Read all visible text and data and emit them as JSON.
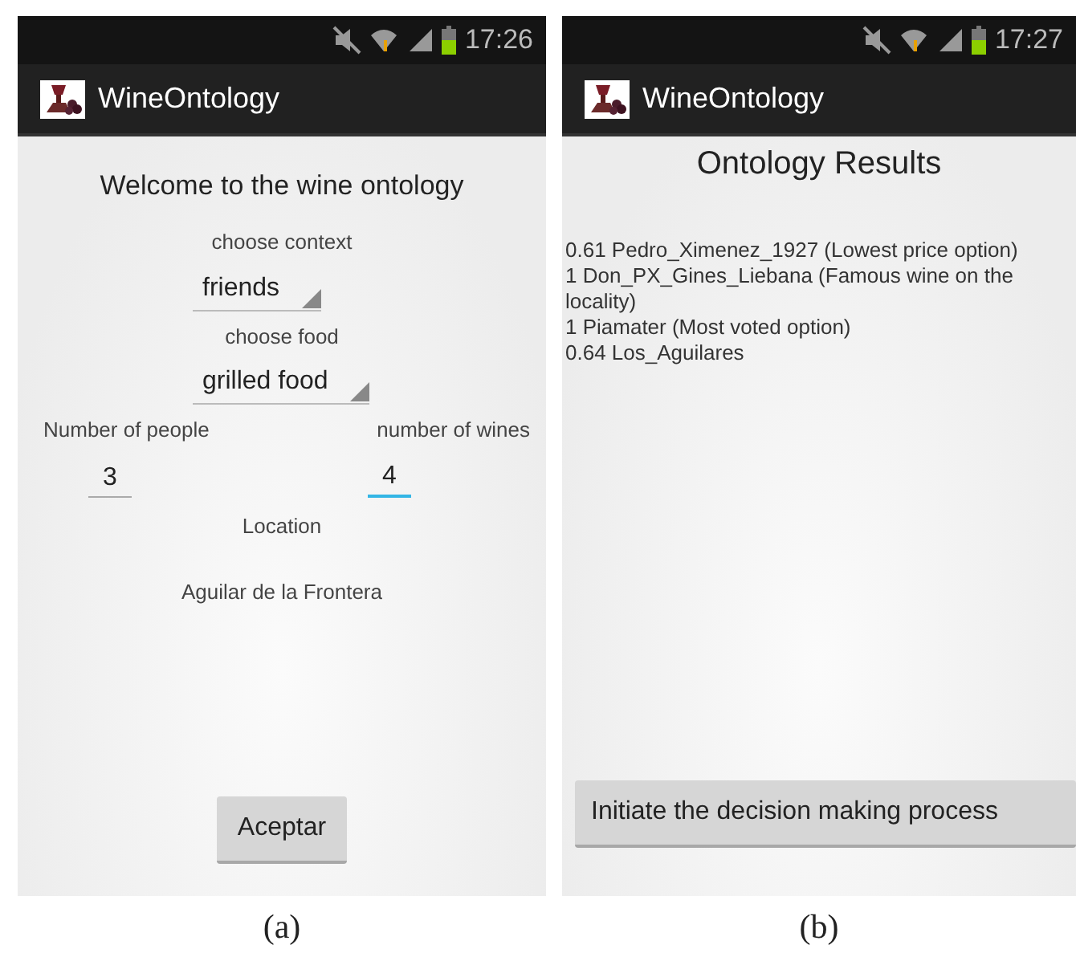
{
  "screens": [
    {
      "kind": "form",
      "caption": "(a)",
      "status_bar": {
        "time": "17:26"
      },
      "app_bar": {
        "title": "WineOntology"
      },
      "heading": "Welcome to the wine ontology",
      "context": {
        "label": "choose context",
        "value": "friends"
      },
      "food": {
        "label": "choose food",
        "value": "grilled food"
      },
      "people": {
        "label": "Number of people",
        "value": "3",
        "focused": false
      },
      "wines": {
        "label": "number of wines",
        "value": "4",
        "focused": true
      },
      "location": {
        "label": "Location",
        "value": "Aguilar de la Frontera"
      },
      "button": "Aceptar"
    },
    {
      "kind": "results",
      "caption": "(b)",
      "status_bar": {
        "time": "17:27"
      },
      "app_bar": {
        "title": "WineOntology"
      },
      "heading": "Ontology Results",
      "results": [
        "0.61 Pedro_Ximenez_1927 (Lowest price option)",
        "1 Don_PX_Gines_Liebana (Famous wine on the locality)",
        "1 Piamater (Most voted option)",
        "0.64 Los_Aguilares"
      ],
      "button": "Initiate the decision making process"
    }
  ]
}
